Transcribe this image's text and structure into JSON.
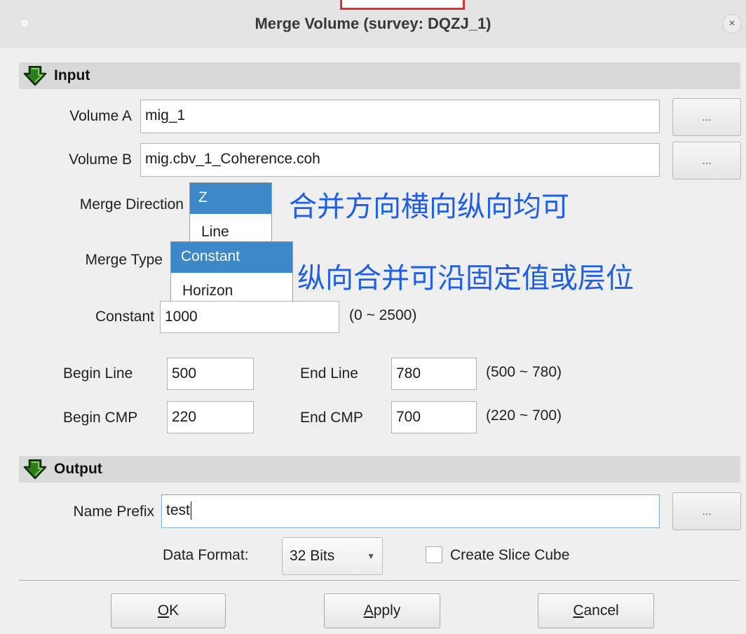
{
  "window": {
    "title": "Merge Volume (survey: DQZJ_1)",
    "close_icon": "×"
  },
  "input_section": {
    "title": "Input",
    "volume_a": {
      "label": "Volume A",
      "value": "mig_1",
      "browse_label": "..."
    },
    "volume_b": {
      "label": "Volume B",
      "value": "mig.cbv_1_Coherence.coh",
      "browse_label": "..."
    },
    "merge_direction": {
      "label": "Merge Direction",
      "options": [
        "Z",
        "Line"
      ],
      "selected": "Z"
    },
    "merge_type": {
      "label": "Merge Type",
      "options": [
        "Constant",
        "Horizon"
      ],
      "selected": "Constant"
    },
    "constant": {
      "label": "Constant",
      "value": "1000",
      "range": "(0 ~ 2500)"
    },
    "begin_line": {
      "label": "Begin Line",
      "value": "500"
    },
    "end_line": {
      "label": "End Line",
      "value": "780"
    },
    "line_range": "(500 ~ 780)",
    "begin_cmp": {
      "label": "Begin CMP",
      "value": "220"
    },
    "end_cmp": {
      "label": "End CMP",
      "value": "700"
    },
    "cmp_range": "(220 ~ 700)"
  },
  "output_section": {
    "title": "Output",
    "name_prefix": {
      "label": "Name Prefix",
      "value": "test",
      "browse_label": "..."
    },
    "data_format": {
      "label": "Data Format:",
      "value": "32 Bits"
    },
    "create_slice_cube": {
      "label": "Create Slice Cube",
      "checked": false
    }
  },
  "buttons": {
    "ok": {
      "mnemonic": "O",
      "rest": "K"
    },
    "apply": {
      "mnemonic": "A",
      "rest": "pply"
    },
    "cancel": {
      "mnemonic": "C",
      "rest": "ancel"
    }
  },
  "annotations": {
    "direction_note": "合并方向横向纵向均可",
    "type_note": "纵向合并可沿固定值或层位"
  },
  "colors": {
    "annotation": "#1e5fe6",
    "selection": "#3c87c8",
    "section_icon": "#2e7d1c",
    "highlight_box": "#e03030"
  }
}
